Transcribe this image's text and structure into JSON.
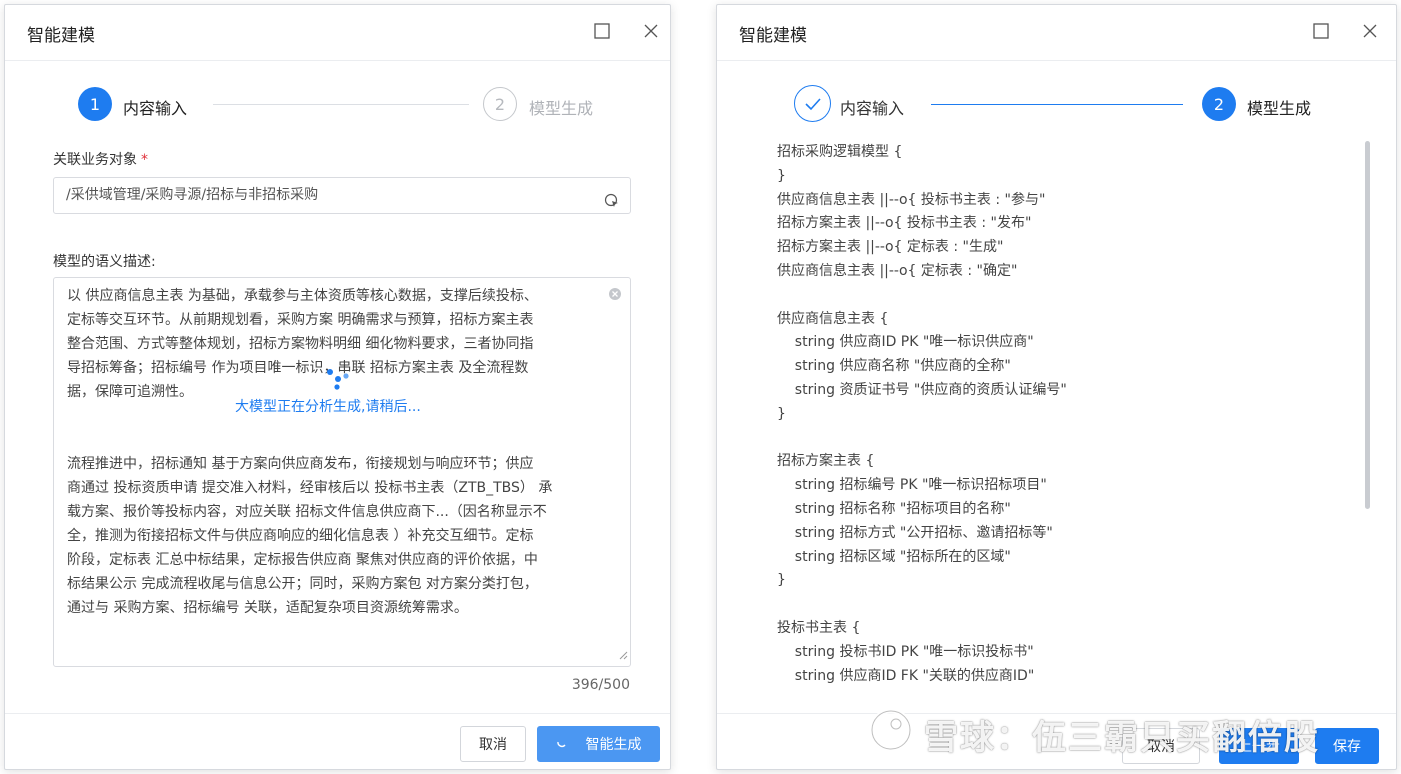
{
  "left_dialog": {
    "title": "智能建模",
    "steps": [
      {
        "number": "1",
        "label": "内容输入",
        "state": "active"
      },
      {
        "number": "2",
        "label": "模型生成",
        "state": "pending"
      }
    ],
    "business_object": {
      "label": "关联业务对象",
      "required_mark": "*",
      "value": "/采供域管理/采购寻源/招标与非招标采购"
    },
    "semantic": {
      "label": "模型的语义描述:",
      "paragraph1": "以 供应商信息主表 为基础，承载参与主体资质等核心数据，支撑后续投标、\n定标等交互环节。从前期规划看，采购方案 明确需求与预算，招标方案主表\n整合范围、方式等整体规划，招标方案物料明细 细化物料要求，三者协同指\n导招标筹备；招标编号 作为项目唯一标识，串联 招标方案主表 及全流程数\n据，保障可追溯性。",
      "loading": "大模型正在分析生成,请稍后...",
      "paragraph2": "流程推进中，招标通知 基于方案向供应商发布，衔接规划与响应环节；供应\n商通过 投标资质申请 提交准入材料，经审核后以 投标书主表（ZTB_TBS） 承\n载方案、报价等投标内容，对应关联 招标文件信息供应商下...（因名称显示不\n全，推测为衔接招标文件与供应商响应的细化信息表 ）补充交互细节。定标\n阶段，定标表 汇总中标结果，定标报告供应商 聚焦对供应商的评价依据，中\n标结果公示 完成流程收尾与信息公开；同时，采购方案包 对方案分类打包，\n通过与 采购方案、招标编号 关联，适配复杂项目资源统筹需求。",
      "counter": "396/500"
    },
    "cancel_label": "取消",
    "generate_label": "智能生成"
  },
  "right_dialog": {
    "title": "智能建模",
    "steps": [
      {
        "label": "内容输入",
        "state": "done"
      },
      {
        "number": "2",
        "label": "模型生成",
        "state": "active"
      }
    ],
    "code": "招标采购逻辑模型 {\n}\n供应商信息主表 ||--o{ 投标书主表 : \"参与\"\n招标方案主表 ||--o{ 投标书主表 : \"发布\"\n招标方案主表 ||--o{ 定标表 : \"生成\"\n供应商信息主表 ||--o{ 定标表 : \"确定\"\n\n供应商信息主表 {\n    string 供应商ID PK \"唯一标识供应商\"\n    string 供应商名称 \"供应商的全称\"\n    string 资质证书号 \"供应商的资质认证编号\"\n}\n\n招标方案主表 {\n    string 招标编号 PK \"唯一标识招标项目\"\n    string 招标名称 \"招标项目的名称\"\n    string 招标方式 \"公开招标、邀请招标等\"\n    string 招标区域 \"招标所在的区域\"\n}\n\n投标书主表 {\n    string 投标书ID PK \"唯一标识投标书\"\n    string 供应商ID FK \"关联的供应商ID\"",
    "cancel_label": "取消",
    "prev_label": "上一步",
    "save_label": "保存",
    "watermark": "雪球：伍三霸只买翻倍股"
  },
  "colors": {
    "primary": "#1e7cf0",
    "primary_light": "#4b97f2",
    "required": "#e0303a"
  }
}
